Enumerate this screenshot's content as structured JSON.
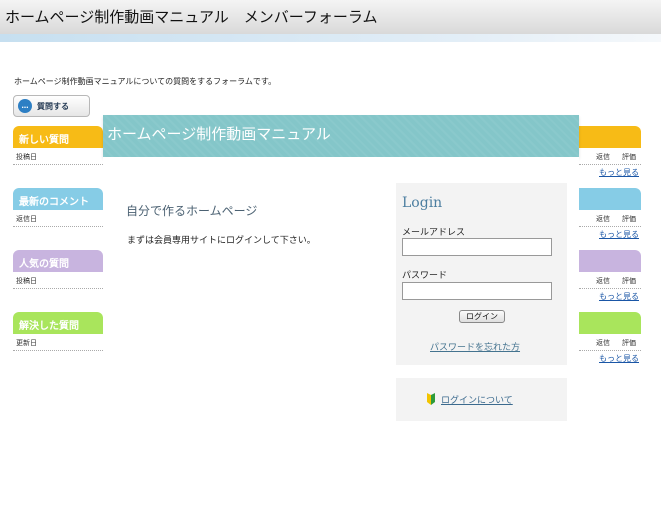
{
  "header": {
    "title": "ホームページ制作動画マニュアル　メンバーフォーラム"
  },
  "intro": "ホームページ制作動画マニュアルについての質問をするフォーラムです。",
  "ask_button": {
    "label": "質問する",
    "icon": "speech-bubble-icon"
  },
  "sections": {
    "new": {
      "title": "新しい質問",
      "sub_left": "投稿日",
      "col1": "返信",
      "col2": "評価",
      "more": "もっと見る",
      "color": "#f7bb16"
    },
    "comments": {
      "title": "最新のコメント",
      "sub_left": "返信日",
      "col1": "返信",
      "col2": "評価",
      "more": "もっと見る",
      "color": "#86cce6"
    },
    "popular": {
      "title": "人気の質問",
      "sub_left": "投稿日",
      "col1": "返信",
      "col2": "評価",
      "more": "もっと見る",
      "color": "#c8b4df"
    },
    "solved": {
      "title": "解決した質問",
      "sub_left": "更新日",
      "col1": "返信",
      "col2": "評価",
      "more": "もっと見る",
      "color": "#a9e55c"
    }
  },
  "modal": {
    "title": "ホームページ制作動画マニュアル",
    "heading": "自分で作るホームページ",
    "text": "まずは会員専用サイトにログインして下さい。",
    "login": {
      "title": "Login",
      "email_label": "メールアドレス",
      "email_value": "",
      "password_label": "パスワード",
      "password_value": "",
      "button": "ログイン",
      "forgot": "パスワードを忘れた方"
    },
    "about_link": "ログインについて",
    "about_icon": "beginner-mark-icon"
  }
}
